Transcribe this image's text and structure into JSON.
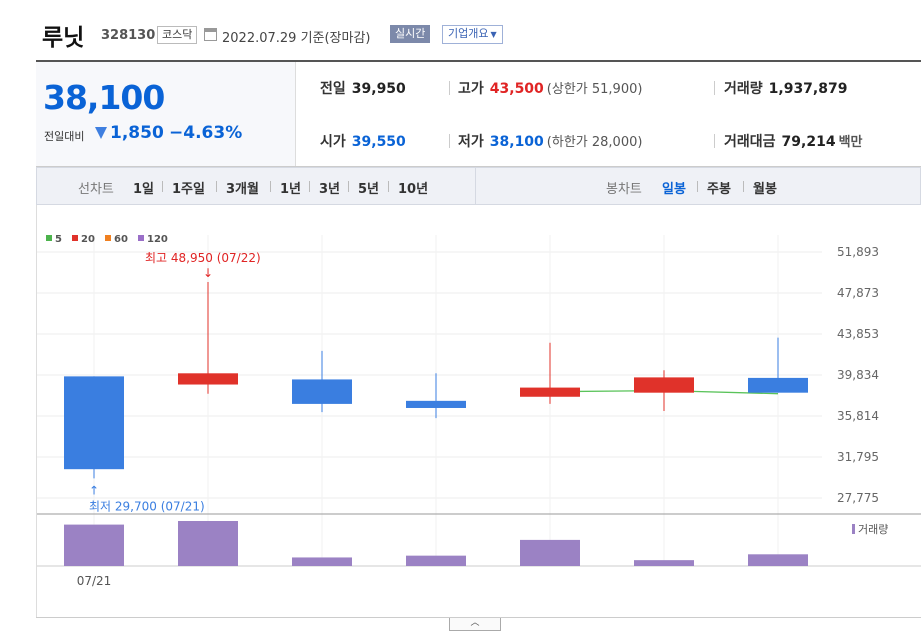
{
  "header": {
    "stock_name": "루닛",
    "stock_code": "328130",
    "market": "코스닥",
    "base_date": "2022.07.29 기준(장마감)",
    "realtime_button": "실시간",
    "overview_button": "기업개요"
  },
  "summary": {
    "current_price": "38,100",
    "change_label": "전일대비",
    "change_value": "1,850",
    "change_pct": "−4.63%",
    "prev_close": {
      "label": "전일",
      "value": "39,950"
    },
    "high": {
      "label": "고가",
      "value": "43,500",
      "limit_text": "(상한가 51,900)"
    },
    "volume": {
      "label": "거래량",
      "value": "1,937,879"
    },
    "open": {
      "label": "시가",
      "value": "39,550"
    },
    "low": {
      "label": "저가",
      "value": "38,100",
      "limit_text": "(하한가 28,000)"
    },
    "trade_value": {
      "label": "거래대금",
      "value": "79,214",
      "unit": "백만"
    }
  },
  "period_bar": {
    "line_chart_label": "선차트",
    "line_periods": [
      "1일",
      "1주일",
      "3개월",
      "1년",
      "3년",
      "5년",
      "10년"
    ],
    "candle_chart_label": "봉차트",
    "candle_periods": [
      "일봉",
      "주봉",
      "월봉"
    ],
    "active_candle_period": "일봉"
  },
  "chart_data": {
    "type": "candlestick",
    "legend": [
      {
        "name": "5",
        "color": "#4cb34c"
      },
      {
        "name": "20",
        "color": "#e0322a"
      },
      {
        "name": "60",
        "color": "#f08020"
      },
      {
        "name": "120",
        "color": "#9a6fc8"
      }
    ],
    "y_ticks": [
      "51,893",
      "47,873",
      "43,853",
      "39,834",
      "35,814",
      "31,795",
      "27,775"
    ],
    "y_tick_values": [
      51893,
      47873,
      43853,
      39834,
      35814,
      31795,
      27775
    ],
    "ylim": [
      27775,
      51893
    ],
    "x_label": "07/21",
    "candles": [
      {
        "open": 39700,
        "close": 30600,
        "high": 39700,
        "low": 29700
      },
      {
        "open": 38900,
        "close": 40000,
        "high": 48950,
        "low": 38000
      },
      {
        "open": 39400,
        "close": 37000,
        "high": 42200,
        "low": 36200
      },
      {
        "open": 37300,
        "close": 36600,
        "high": 40000,
        "low": 35600
      },
      {
        "open": 37700,
        "close": 38600,
        "high": 43000,
        "low": 37000
      },
      {
        "open": 38100,
        "close": 39600,
        "high": 40300,
        "low": 36300
      },
      {
        "open": 39550,
        "close": 38100,
        "high": 43500,
        "low": 38100
      }
    ],
    "ma5_line": [
      null,
      null,
      null,
      null,
      38200,
      38300,
      38000
    ],
    "volume_label": "거래량",
    "volume_rel": [
      0.92,
      1.0,
      0.19,
      0.23,
      0.58,
      0.13,
      0.26
    ],
    "high_annotation": "최고 48,950 (07/22)",
    "low_annotation": "최저 29,700 (07/21)",
    "colors": {
      "up": "#e0322a",
      "down": "#3a7ee0",
      "volume": "#9b82c4",
      "ma5": "#5ac35a"
    }
  }
}
